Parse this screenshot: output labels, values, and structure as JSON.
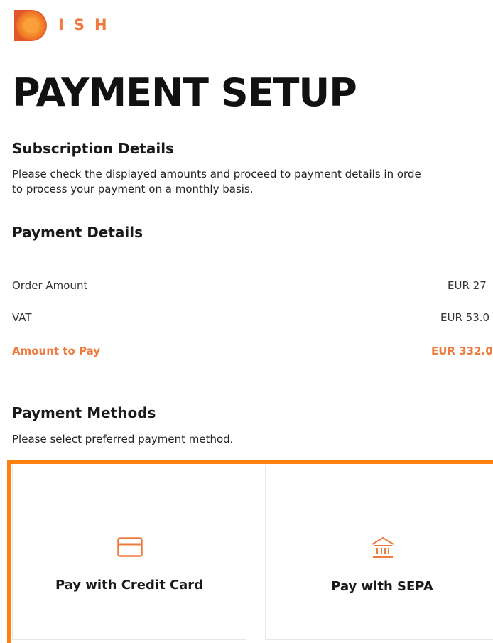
{
  "brand": {
    "logo_text": "ISH",
    "accent_color": "#f07a3e",
    "selection_color": "#ff7f0f"
  },
  "page": {
    "title": "PAYMENT SETUP"
  },
  "subscription": {
    "heading": "Subscription Details",
    "description_line1": "Please check the displayed amounts and proceed to payment details in orde",
    "description_line2": "to process your payment on a monthly basis."
  },
  "payment_details": {
    "heading": "Payment Details",
    "rows": [
      {
        "label": "Order Amount",
        "value": "EUR 27"
      },
      {
        "label": "VAT",
        "value": "EUR 53.0"
      },
      {
        "label": "Amount to Pay",
        "value": "EUR 332.0"
      }
    ]
  },
  "payment_methods": {
    "heading": "Payment Methods",
    "description": "Please select preferred payment method.",
    "options": [
      {
        "label": "Pay with Credit Card",
        "icon": "credit-card-icon",
        "selected": true
      },
      {
        "label": "Pay with SEPA",
        "icon": "bank-icon",
        "selected": false
      }
    ]
  }
}
